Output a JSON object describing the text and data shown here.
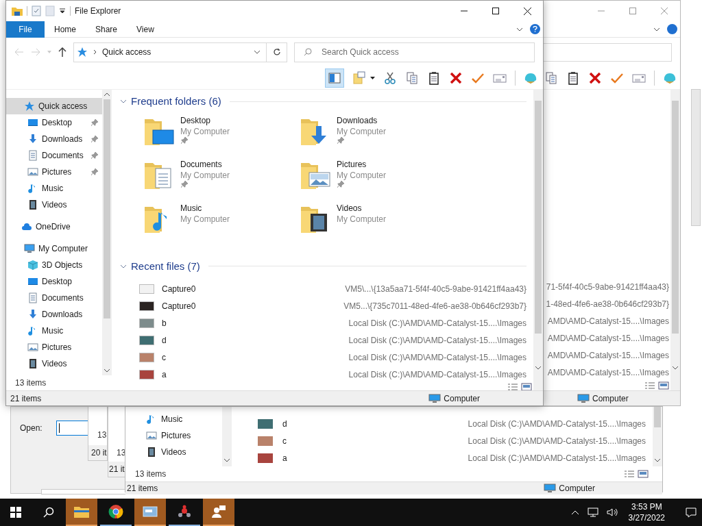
{
  "main_window": {
    "title": "File Explorer",
    "ribbon_tabs": [
      {
        "label": "File",
        "selected": true
      },
      {
        "label": "Home",
        "selected": false
      },
      {
        "label": "Share",
        "selected": false
      },
      {
        "label": "View",
        "selected": false
      }
    ],
    "address": "Quick access",
    "search": {
      "placeholder": "Search Quick access"
    },
    "nav_items": [
      {
        "label": "Quick access",
        "kind": "star",
        "selected": true,
        "pinned": false,
        "children": [
          {
            "label": "Desktop",
            "kind": "desktop",
            "selected": false,
            "pinned": true
          },
          {
            "label": "Downloads",
            "kind": "downloads",
            "selected": false,
            "pinned": true
          },
          {
            "label": "Documents",
            "kind": "documents",
            "selected": false,
            "pinned": true
          },
          {
            "label": "Pictures",
            "kind": "pictures",
            "selected": false,
            "pinned": true
          },
          {
            "label": "Music",
            "kind": "music",
            "selected": false,
            "pinned": false
          },
          {
            "label": "Videos",
            "kind": "videos",
            "selected": false,
            "pinned": false
          }
        ]
      },
      {
        "label": "OneDrive",
        "kind": "cloud",
        "selected": false,
        "pinned": false
      },
      {
        "label": "My Computer",
        "kind": "computer",
        "selected": false,
        "pinned": false,
        "children": [
          {
            "label": "3D Objects",
            "kind": "cube",
            "selected": false,
            "pinned": false
          },
          {
            "label": "Desktop",
            "kind": "desktop",
            "selected": false,
            "pinned": false
          },
          {
            "label": "Documents",
            "kind": "documents",
            "selected": false,
            "pinned": false
          },
          {
            "label": "Downloads",
            "kind": "downloads",
            "selected": false,
            "pinned": false
          },
          {
            "label": "Music",
            "kind": "music",
            "selected": false,
            "pinned": false
          },
          {
            "label": "Pictures",
            "kind": "pictures",
            "selected": false,
            "pinned": false
          },
          {
            "label": "Videos",
            "kind": "videos",
            "selected": false,
            "pinned": false
          }
        ]
      }
    ],
    "frequent_folders": {
      "title": "Frequent folders (6)",
      "items": [
        {
          "name": "Desktop",
          "location": "My Computer",
          "kind": "desktop",
          "pinned": true
        },
        {
          "name": "Downloads",
          "location": "My Computer",
          "kind": "downloads",
          "pinned": true
        },
        {
          "name": "Documents",
          "location": "My Computer",
          "kind": "documents",
          "pinned": true
        },
        {
          "name": "Pictures",
          "location": "My Computer",
          "kind": "pictures",
          "pinned": true
        },
        {
          "name": "Music",
          "location": "My Computer",
          "kind": "music",
          "pinned": false
        },
        {
          "name": "Videos",
          "location": "My Computer",
          "kind": "videos",
          "pinned": false
        }
      ]
    },
    "recent_files": {
      "title": "Recent files (7)",
      "items": [
        {
          "name": "Capture0",
          "path": "VM5\\...\\{13a5aa71-5f4f-40c5-9abe-91421ff4aa43}",
          "color": "#f2f2f2"
        },
        {
          "name": "Capture0",
          "path": "VM5...\\{735c7011-48ed-4fe6-ae38-0b646cf293b7}",
          "color": "#2b2422"
        },
        {
          "name": "b",
          "path": "Local Disk (C:)\\AMD\\AMD-Catalyst-15....\\Images",
          "color": "#7d8c8c"
        },
        {
          "name": "d",
          "path": "Local Disk (C:)\\AMD\\AMD-Catalyst-15....\\Images",
          "color": "#3f6e72"
        },
        {
          "name": "c",
          "path": "Local Disk (C:)\\AMD\\AMD-Catalyst-15....\\Images",
          "color": "#b9826a"
        },
        {
          "name": "a",
          "path": "Local Disk (C:)\\AMD\\AMD-Catalyst-15....\\Images",
          "color": "#a8443e"
        }
      ]
    },
    "pane_status": "13 items",
    "status": "21 items",
    "location": "Computer"
  },
  "back_window": {
    "paths": [
      "71-5f4f-40c5-9abe-91421ff4aa43}",
      "1-48ed-4fe6-ae38-0b646cf293b7}",
      "AMD\\AMD-Catalyst-15....\\Images",
      "AMD\\AMD-Catalyst-15....\\Images",
      "AMD\\AMD-Catalyst-15....\\Images",
      "AMD\\AMD-Catalyst-15....\\Images"
    ],
    "location": "Computer"
  },
  "lower_window": {
    "nav_items": [
      {
        "label": "Music",
        "kind": "music"
      },
      {
        "label": "Pictures",
        "kind": "pictures"
      },
      {
        "label": "Videos",
        "kind": "videos"
      }
    ],
    "recent_files": [
      {
        "name": "d",
        "path": "Local Disk (C:)\\AMD\\AMD-Catalyst-15....\\Images",
        "color": "#3f6e72"
      },
      {
        "name": "c",
        "path": "Local Disk (C:)\\AMD\\AMD-Catalyst-15....\\Images",
        "color": "#b9826a"
      },
      {
        "name": "a",
        "path": "Local Disk (C:)\\AMD\\AMD-Catalyst-15....\\Images",
        "color": "#a8443e"
      }
    ],
    "pane_status": "13 items",
    "status": "21 items",
    "location": "Computer"
  },
  "stacked_windows": [
    {
      "pane_status": "13",
      "status": "20 it"
    },
    {
      "pane_status": "13",
      "status": "21 it"
    }
  ],
  "run_dialog": {
    "open_label": "Open:"
  },
  "taskbar": {
    "apps": [
      {
        "kind": "explorer",
        "highlighted": true
      },
      {
        "kind": "chrome",
        "highlighted": false
      },
      {
        "kind": "window",
        "highlighted": true
      },
      {
        "kind": "molecule",
        "highlighted": false
      },
      {
        "kind": "people",
        "highlighted": true
      }
    ],
    "time": "3:53 PM",
    "date": "3/27/2022"
  }
}
